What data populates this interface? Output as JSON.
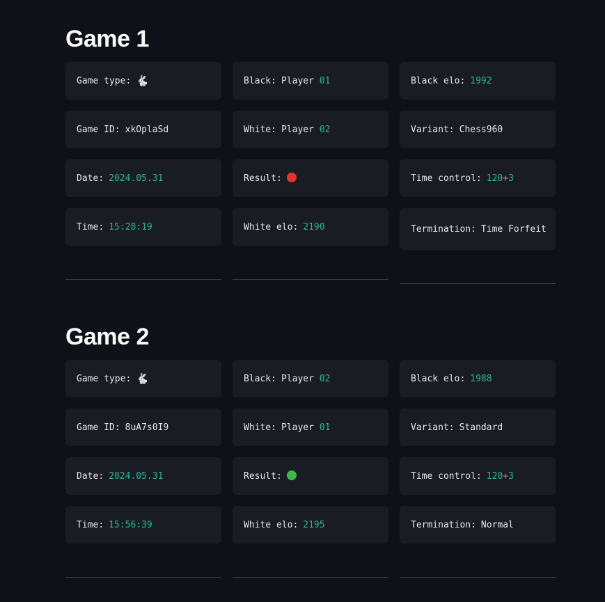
{
  "colors": {
    "background": "#0e1117",
    "card": "#1a1c24",
    "number": "#2bb59a",
    "plus": "#e07b3a",
    "loss": "#e0352b",
    "win": "#3fb94a"
  },
  "games": [
    {
      "title": "Game 1",
      "game_type": {
        "key": "Game type",
        "icon": "rabbit-icon",
        "glyph": "🐇"
      },
      "game_id": {
        "key": "Game ID",
        "value": "xkOplaSd"
      },
      "date": {
        "key": "Date",
        "value": "2024.05.31"
      },
      "time": {
        "key": "Time",
        "value": "15:28:19"
      },
      "black": {
        "key": "Black",
        "prefix": "Player",
        "num": "01"
      },
      "white": {
        "key": "White",
        "prefix": "Player",
        "num": "02"
      },
      "result": {
        "key": "Result",
        "icon": "red-circle-icon",
        "color": "#e0352b"
      },
      "white_elo": {
        "key": "White elo",
        "value": "2190"
      },
      "black_elo": {
        "key": "Black elo",
        "value": "1992"
      },
      "variant": {
        "key": "Variant",
        "value": "Chess960"
      },
      "time_control": {
        "key": "Time control",
        "base": "120",
        "plus": "+",
        "inc": "3"
      },
      "termination": {
        "key": "Termination",
        "value": "Time Forfeit"
      }
    },
    {
      "title": "Game 2",
      "game_type": {
        "key": "Game type",
        "icon": "rabbit-icon",
        "glyph": "🐇"
      },
      "game_id": {
        "key": "Game ID",
        "value": "8uA7s0I9"
      },
      "date": {
        "key": "Date",
        "value": "2024.05.31"
      },
      "time": {
        "key": "Time",
        "value": "15:56:39"
      },
      "black": {
        "key": "Black",
        "prefix": "Player",
        "num": "02"
      },
      "white": {
        "key": "White",
        "prefix": "Player",
        "num": "01"
      },
      "result": {
        "key": "Result",
        "icon": "green-circle-icon",
        "color": "#3fb94a"
      },
      "white_elo": {
        "key": "White elo",
        "value": "2195"
      },
      "black_elo": {
        "key": "Black elo",
        "value": "1988"
      },
      "variant": {
        "key": "Variant",
        "value": "Standard"
      },
      "time_control": {
        "key": "Time control",
        "base": "120",
        "plus": "+",
        "inc": "3"
      },
      "termination": {
        "key": "Termination",
        "value": "Normal"
      }
    }
  ]
}
